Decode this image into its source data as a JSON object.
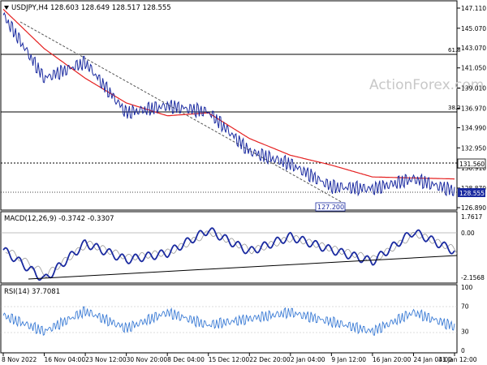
{
  "main": {
    "header": "USDJPY,H4  128.603 128.649 128.517 128.555",
    "watermark": "ActionForex.com",
    "y_ticks": [
      "147.110",
      "145.070",
      "143.070",
      "141.050",
      "139.010",
      "136.970",
      "134.990",
      "132.950",
      "130.910",
      "128.870",
      "126.890"
    ],
    "current_price": "128.555",
    "level_131": "131.560",
    "low_label": "127.200",
    "fib_618": "61.8",
    "fib_382": "38.2",
    "colors": {
      "price": "#1a2aa0",
      "ma": "#e52020",
      "current_box": "#1a2aa0"
    }
  },
  "macd": {
    "header": "MACD(12,26,9) -0.3742 -0.3307",
    "y_ticks": [
      "1.7617",
      "0.00",
      "-2.1568"
    ]
  },
  "rsi": {
    "header": "RSI(14) 37.7081",
    "y_ticks": [
      "100",
      "70",
      "30",
      "0"
    ]
  },
  "x_axis": {
    "labels": [
      "8 Nov 2022",
      "16 Nov 04:00",
      "23 Nov 12:00",
      "30 Nov 20:00",
      "8 Dec 04:00",
      "15 Dec 12:00",
      "22 Dec 20:00",
      "2 Jan 04:00",
      "9 Jan 12:00",
      "16 Jan 20:00",
      "24 Jan 04:00",
      "31 Jan 12:00"
    ]
  },
  "chart_data": {
    "type": "line",
    "title": "USDJPY,H4",
    "x": [
      "8 Nov 2022",
      "16 Nov 04:00",
      "23 Nov 12:00",
      "30 Nov 20:00",
      "8 Dec 04:00",
      "15 Dec 12:00",
      "22 Dec 20:00",
      "2 Jan 04:00",
      "9 Jan 12:00",
      "16 Jan 20:00",
      "24 Jan 04:00",
      "31 Jan 12:00"
    ],
    "ylim": [
      126.89,
      147.11
    ],
    "series": [
      {
        "name": "USDJPY",
        "values": [
          146.4,
          140.0,
          141.6,
          136.5,
          137.2,
          136.6,
          132.6,
          131.3,
          129.0,
          128.8,
          129.8,
          128.6
        ]
      },
      {
        "name": "MA",
        "values": [
          147.0,
          143.0,
          140.0,
          137.5,
          136.2,
          136.5,
          133.9,
          132.2,
          131.2,
          130.0,
          129.9,
          129.8
        ]
      }
    ],
    "key_levels": [
      143.0,
      137.0,
      131.56
    ],
    "macd": {
      "ylim": [
        -2.1568,
        1.7617
      ],
      "values": [
        -0.3,
        -2.1,
        0.1,
        -0.9,
        -0.5,
        0.9,
        -0.4,
        0.5,
        -0.3,
        -1.0,
        0.8,
        -0.37
      ]
    },
    "rsi": {
      "ylim": [
        0,
        100
      ],
      "values": [
        55,
        30,
        62,
        35,
        60,
        40,
        50,
        60,
        45,
        30,
        60,
        37.7
      ]
    }
  }
}
